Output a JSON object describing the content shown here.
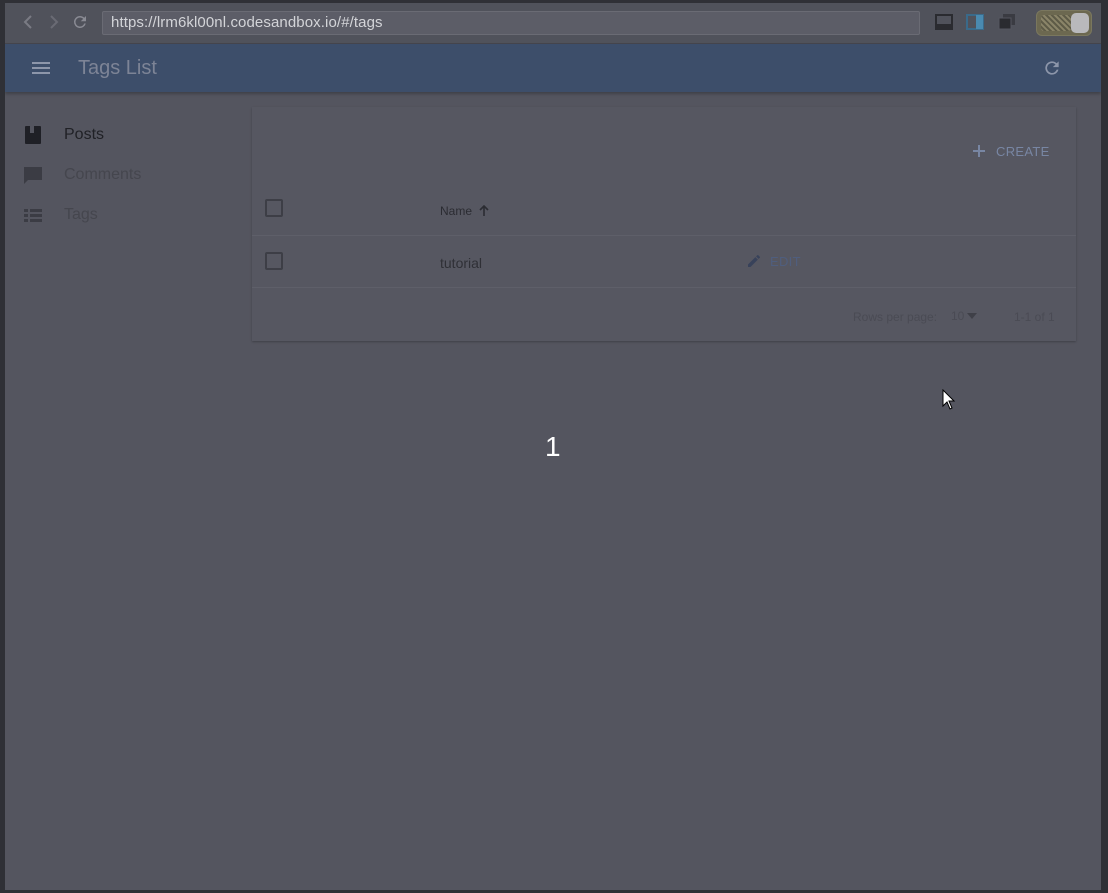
{
  "browser": {
    "url": "https://lrm6kl00nl.codesandbox.io/#/tags"
  },
  "app_bar": {
    "title": "Tags List"
  },
  "sidebar": {
    "items": [
      {
        "label": "Posts",
        "icon": "book-icon"
      },
      {
        "label": "Comments",
        "icon": "chat-bubble-icon"
      },
      {
        "label": "Tags",
        "icon": "list-icon"
      }
    ]
  },
  "list": {
    "create_label": "CREATE",
    "columns": [
      {
        "label": "Name",
        "sort": "ascending"
      }
    ],
    "rows": [
      {
        "name": "tutorial",
        "edit_label": "EDIT"
      }
    ],
    "footer": {
      "rows_per_page_label": "Rows per page:",
      "rows_per_page_value": "10",
      "range_text": "1-1 of 1"
    }
  },
  "overlay": {
    "number": "1"
  },
  "colors": {
    "app_bar": "#3d4e6a",
    "page_bg": "#54555f",
    "accent": "#7886a3"
  }
}
